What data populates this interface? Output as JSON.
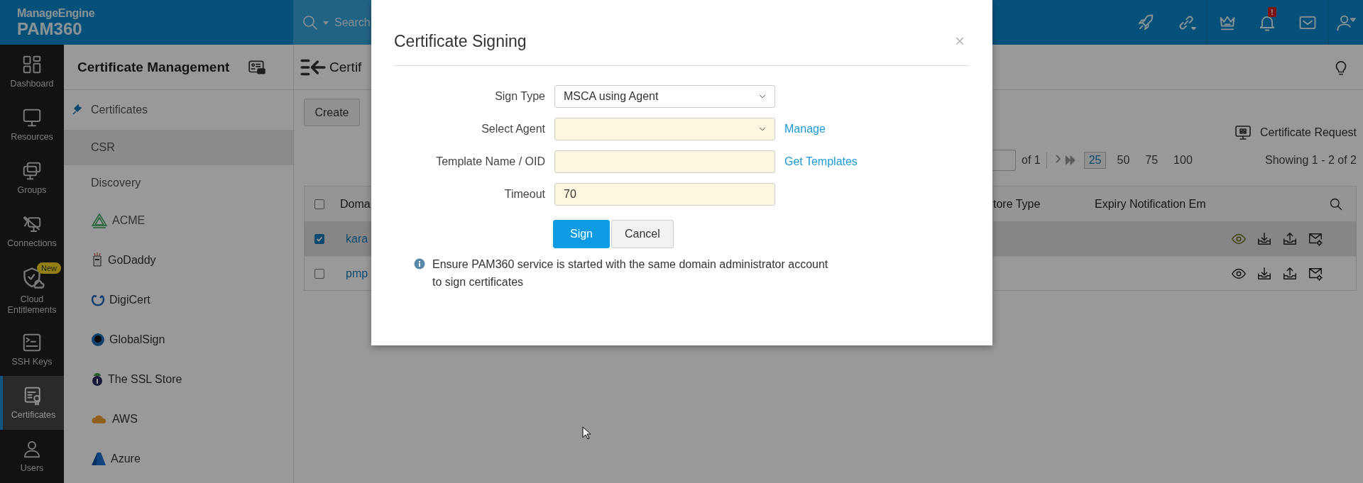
{
  "header": {
    "brand": "ManageEngine",
    "product": "PAM360",
    "search": {
      "placeholder": "Search"
    },
    "notification_badge": "!"
  },
  "nav": [
    {
      "label": "Dashboard",
      "selected": false
    },
    {
      "label": "Resources",
      "selected": false
    },
    {
      "label": "Groups",
      "selected": false
    },
    {
      "label": "Connections",
      "selected": false
    },
    {
      "label": "Cloud Entitlements",
      "selected": false,
      "badge": "New"
    },
    {
      "label": "SSH Keys",
      "selected": false
    },
    {
      "label": "Certificates",
      "selected": true
    },
    {
      "label": "Users",
      "selected": false
    }
  ],
  "sidebar": {
    "title": "Certificate Management",
    "items": [
      {
        "label": "Certificates",
        "selected": false
      },
      {
        "label": "CSR",
        "selected": true
      },
      {
        "label": "Discovery",
        "selected": false
      },
      {
        "label": "ACME",
        "selected": false
      },
      {
        "label": "GoDaddy",
        "selected": false
      },
      {
        "label": "DigiCert",
        "selected": false
      },
      {
        "label": "GlobalSign",
        "selected": false
      },
      {
        "label": "The SSL Store",
        "selected": false
      },
      {
        "label": "AWS",
        "selected": false
      },
      {
        "label": "Azure",
        "selected": false
      }
    ]
  },
  "content": {
    "title": "Certif",
    "create_button": "Create",
    "certificate_request": "Certificate Request",
    "pagination": {
      "of": "of 1",
      "page_sizes": [
        {
          "label": "25",
          "selected": true
        },
        {
          "label": "50",
          "selected": false
        },
        {
          "label": "75",
          "selected": false
        },
        {
          "label": "100",
          "selected": false
        }
      ],
      "showing": "Showing 1 - 2 of 2"
    },
    "table": {
      "select_all_checked": false,
      "column_1": "Doma",
      "column_2": "tore Type",
      "column_3": "Expiry Notification Em",
      "rows": [
        {
          "checked": true,
          "selected": true,
          "cell": "kara"
        },
        {
          "checked": false,
          "selected": false,
          "cell": "pmp"
        }
      ]
    }
  },
  "dialog": {
    "title": "Certificate Signing",
    "close": "×",
    "fields": [
      {
        "label": "Sign Type",
        "kind": "select",
        "highlighted": false,
        "value": "MSCA using Agent"
      },
      {
        "label": "Select Agent",
        "kind": "select",
        "highlighted": true,
        "link": "Manage"
      },
      {
        "label": "Template Name / OID",
        "kind": "text",
        "highlighted": true,
        "link": "Get Templates"
      },
      {
        "label": "Timeout",
        "kind": "text",
        "highlighted": true,
        "value": "70"
      }
    ],
    "buttons": [
      {
        "label": "Sign",
        "kind": "primary"
      },
      {
        "label": "Cancel",
        "kind": "secondary"
      }
    ],
    "note": "Ensure PAM360 service is started with the same domain administrator account to sign certificates"
  }
}
